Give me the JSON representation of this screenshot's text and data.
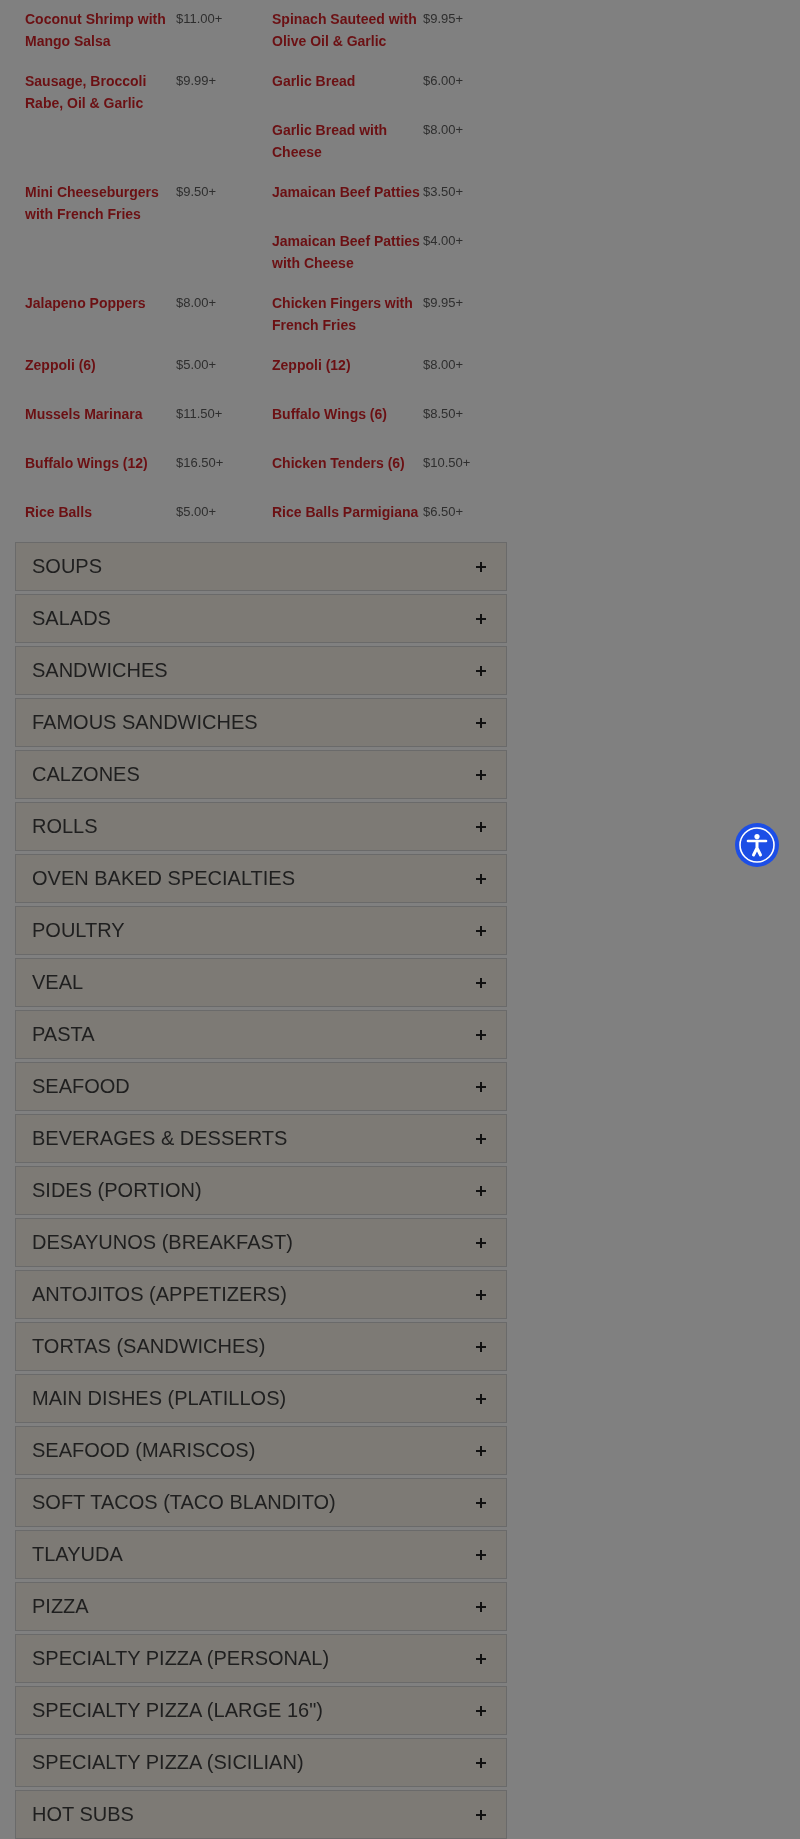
{
  "menu_items": [
    {
      "name": "Coconut Shrimp with Mango Salsa",
      "price": "$11.00+"
    },
    {
      "name": "Spinach Sauteed with Olive Oil & Garlic",
      "price": "$9.95+"
    },
    {
      "name": "Sausage, Broccoli Rabe, Oil & Garlic",
      "price": "$9.99+"
    },
    {
      "name": "Garlic Bread",
      "price": "$6.00+"
    },
    {
      "name": "Garlic Bread with Cheese",
      "price": "$8.00+"
    },
    {
      "name": "Mini Cheeseburgers with French Fries",
      "price": "$9.50+"
    },
    {
      "name": "Jamaican Beef Patties",
      "price": "$3.50+"
    },
    {
      "name": "Jamaican Beef Patties with Cheese",
      "price": "$4.00+"
    },
    {
      "name": "Jalapeno Poppers",
      "price": "$8.00+"
    },
    {
      "name": "Chicken Fingers with French Fries",
      "price": "$9.95+"
    },
    {
      "name": "Zeppoli (6)",
      "price": "$5.00+"
    },
    {
      "name": "Zeppoli (12)",
      "price": "$8.00+"
    },
    {
      "name": "Mussels Marinara",
      "price": "$11.50+"
    },
    {
      "name": "Buffalo Wings (6)",
      "price": "$8.50+"
    },
    {
      "name": "Buffalo Wings (12)",
      "price": "$16.50+"
    },
    {
      "name": "Chicken Tenders (6)",
      "price": "$10.50+"
    },
    {
      "name": "Rice Balls",
      "price": "$5.00+"
    },
    {
      "name": "Rice Balls Parmigiana",
      "price": "$6.50+"
    }
  ],
  "categories": [
    {
      "title": "SOUPS",
      "expanded": false
    },
    {
      "title": "SALADS",
      "expanded": false
    },
    {
      "title": "SANDWICHES",
      "expanded": false
    },
    {
      "title": "FAMOUS SANDWICHES",
      "expanded": false
    },
    {
      "title": "CALZONES",
      "expanded": false
    },
    {
      "title": "ROLLS",
      "expanded": false
    },
    {
      "title": "OVEN BAKED SPECIALTIES",
      "expanded": false
    },
    {
      "title": "POULTRY",
      "expanded": false
    },
    {
      "title": "VEAL",
      "expanded": false
    },
    {
      "title": "PASTA",
      "expanded": false
    },
    {
      "title": "SEAFOOD",
      "expanded": false
    },
    {
      "title": "BEVERAGES & DESSERTS",
      "expanded": false
    },
    {
      "title": "SIDES (PORTION)",
      "expanded": false
    },
    {
      "title": "DESAYUNOS (BREAKFAST)",
      "expanded": false
    },
    {
      "title": "ANTOJITOS (APPETIZERS)",
      "expanded": false
    },
    {
      "title": "TORTAS (SANDWICHES)",
      "expanded": false
    },
    {
      "title": "MAIN DISHES (PLATILLOS)",
      "expanded": false
    },
    {
      "title": "SEAFOOD (MARISCOS)",
      "expanded": false
    },
    {
      "title": "SOFT TACOS (TACO BLANDITO)",
      "expanded": false
    },
    {
      "title": "TLAYUDA",
      "expanded": false
    },
    {
      "title": "PIZZA",
      "expanded": false
    },
    {
      "title": "SPECIALTY PIZZA (PERSONAL)",
      "expanded": false
    },
    {
      "title": "SPECIALTY PIZZA (LARGE 16\")",
      "expanded": false
    },
    {
      "title": "SPECIALTY PIZZA (SICILIAN)",
      "expanded": false
    },
    {
      "title": "HOT SUBS",
      "expanded": false
    }
  ]
}
